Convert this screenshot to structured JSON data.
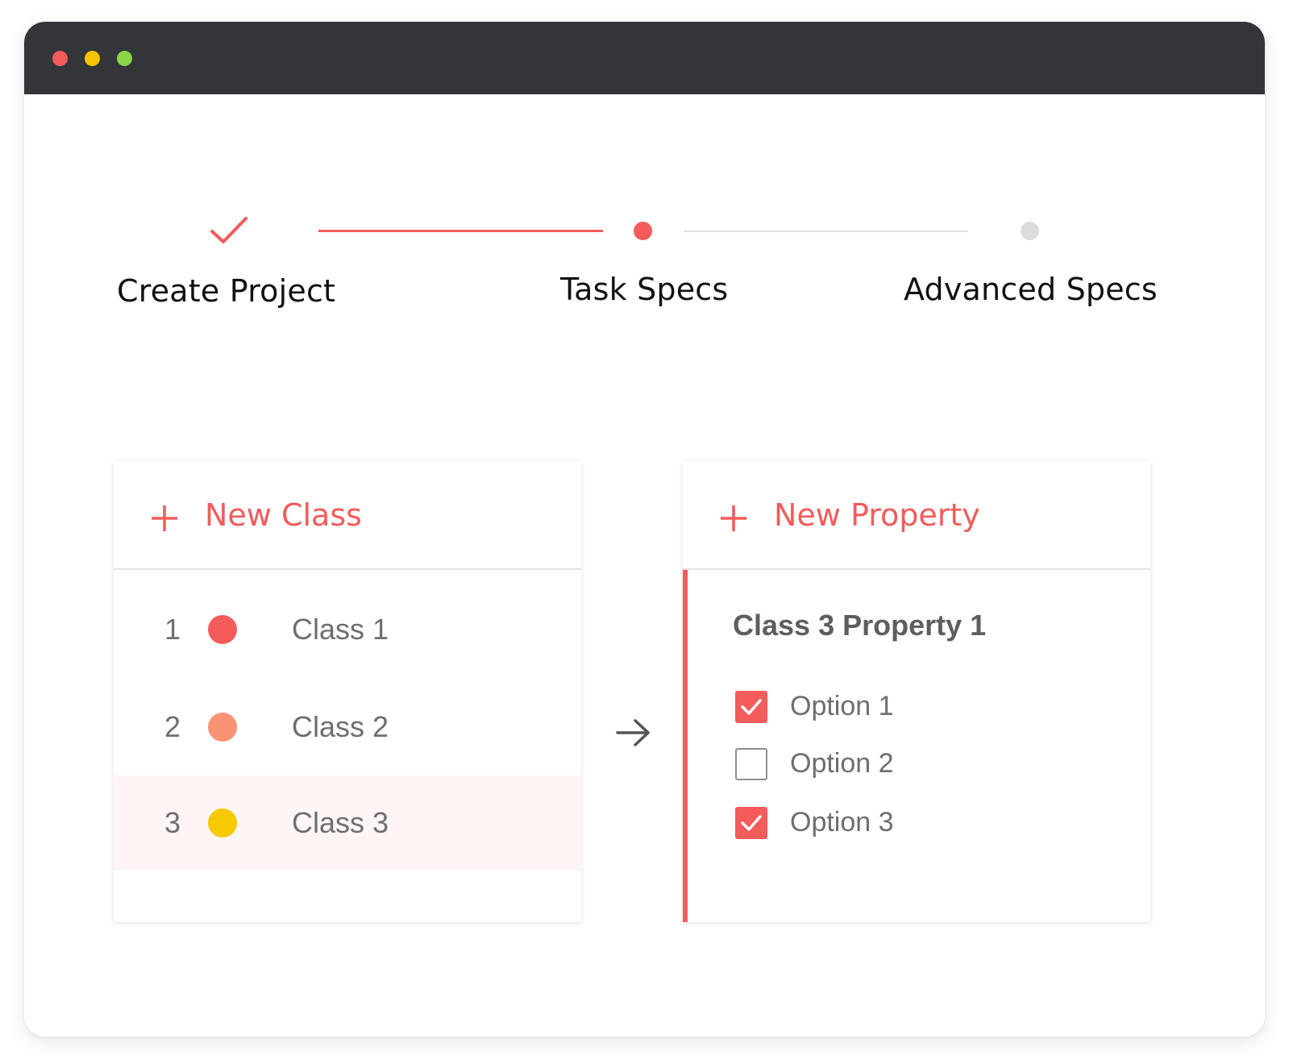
{
  "window": {
    "controls": [
      "close",
      "minimize",
      "maximize"
    ],
    "colors": {
      "titlebar": "#333538",
      "close": "#f45b5b",
      "minimize": "#f7c300",
      "maximize": "#8bd54a"
    }
  },
  "stepper": {
    "steps": [
      {
        "label": "Create Project",
        "state": "completed",
        "icon": "check-icon"
      },
      {
        "label": "Task Specs",
        "state": "active"
      },
      {
        "label": "Advanced Specs",
        "state": "pending"
      }
    ],
    "colors": {
      "accent": "#f45b5b",
      "pending_dot": "#dcdcdc",
      "pending_line": "#e0e0e0"
    }
  },
  "classes_panel": {
    "add_label": "New Class",
    "add_icon": "plus-icon",
    "items": [
      {
        "number": "1",
        "name": "Class 1",
        "color": "#f45b5b",
        "selected": false
      },
      {
        "number": "2",
        "name": "Class 2",
        "color": "#fa9373",
        "selected": false
      },
      {
        "number": "3",
        "name": "Class 3",
        "color": "#f7c900",
        "selected": true
      }
    ]
  },
  "connector_icon": "arrow-right-icon",
  "properties_panel": {
    "add_label": "New Property",
    "add_icon": "plus-icon",
    "property_title": "Class 3 Property 1",
    "options": [
      {
        "label": "Option 1",
        "checked": true
      },
      {
        "label": "Option 2",
        "checked": false
      },
      {
        "label": "Option 3",
        "checked": true
      }
    ]
  },
  "accent_color": "#f45b5b"
}
